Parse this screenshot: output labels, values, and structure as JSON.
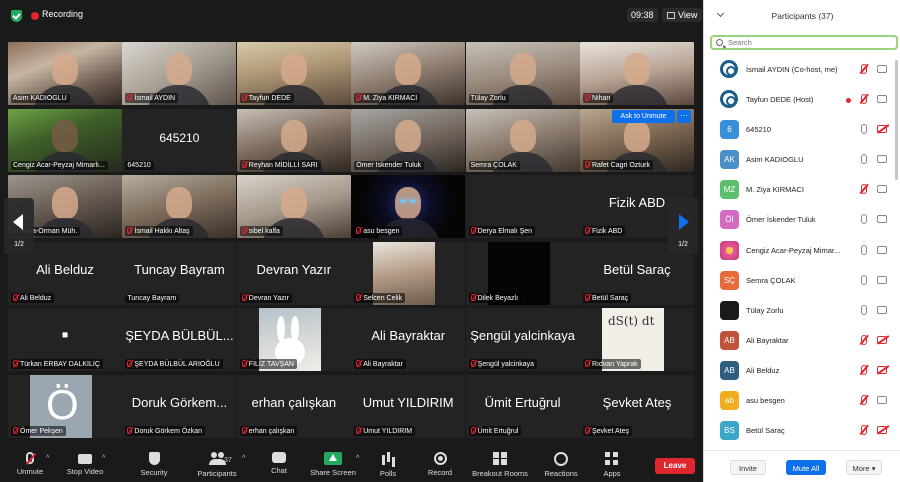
{
  "topbar": {
    "recording_label": "Recording",
    "timer": "09:38",
    "view_label": "View"
  },
  "grid": {
    "ask_to_unmute": "Ask to Unmute",
    "ask_more": "···",
    "page_left": "1/2",
    "page_right": "1/2",
    "tiles": [
      {
        "label": "Asim KADIOGLU",
        "display": "",
        "muted": false
      },
      {
        "label": "İsmail AYDIN",
        "display": "",
        "muted": true
      },
      {
        "label": "Tayfun DEDE",
        "display": "",
        "muted": true
      },
      {
        "label": "M. Ziya KIRMACI",
        "display": "",
        "muted": true
      },
      {
        "label": "Tülay Zorlu",
        "display": "",
        "muted": false
      },
      {
        "label": "Nihan",
        "display": "",
        "muted": true
      },
      {
        "label": "Cengiz Acar-Peyzaj Mimarlı...",
        "display": "",
        "muted": false
      },
      {
        "label": "645210",
        "display": "645210",
        "muted": false
      },
      {
        "label": "Reyhan MİDİLLİ SARI",
        "display": "",
        "muted": true
      },
      {
        "label": "Ömer İskender Tuluk",
        "display": "",
        "muted": false
      },
      {
        "label": "Semra ÇOLAK",
        "display": "",
        "muted": false
      },
      {
        "label": "Rafet Cagri Ozturk",
        "display": "",
        "muted": true
      },
      {
        "label": "er Kara-Orman Müh.",
        "display": "",
        "muted": false
      },
      {
        "label": "İsmail Hakkı Altaş",
        "display": "",
        "muted": true
      },
      {
        "label": "sibel kalfa",
        "display": "",
        "muted": true
      },
      {
        "label": "asu besgen",
        "display": "",
        "muted": true
      },
      {
        "label": "Derya Elmalı Şen",
        "display": "",
        "muted": true
      },
      {
        "label": "Fizik ABD",
        "display": "Fizik ABD",
        "muted": true
      },
      {
        "label": "Ali Belduz",
        "display": "Ali Belduz",
        "muted": true
      },
      {
        "label": "Tuncay Bayram",
        "display": "Tuncay Bayram",
        "muted": false
      },
      {
        "label": "Devran Yazır",
        "display": "Devran Yazır",
        "muted": true
      },
      {
        "label": "Selcen Celik",
        "display": "",
        "muted": true
      },
      {
        "label": "Dilek Beyazlı",
        "display": "",
        "muted": true
      },
      {
        "label": "Betül Saraç",
        "display": "Betül Saraç",
        "muted": true
      },
      {
        "label": "Türkan ERBAY DALKILIÇ",
        "display": "▪",
        "muted": true
      },
      {
        "label": "ŞEYDA BÜLBÜL ARIOĞLU",
        "display": "ŞEYDA BÜLBÜL...",
        "muted": true
      },
      {
        "label": "FİLİZ TAVŞAN",
        "display": "",
        "muted": true
      },
      {
        "label": "Ali Bayraktar",
        "display": "Ali Bayraktar",
        "muted": true
      },
      {
        "label": "Şengül yalcinkaya",
        "display": "Şengül yalcinkaya",
        "muted": true
      },
      {
        "label": "Rıdvan Yaprak",
        "display": "",
        "muted": true
      },
      {
        "label": "Ömer Pekşen",
        "display": "",
        "muted": true
      },
      {
        "label": "Doruk Görkem Özkan",
        "display": "Doruk Görkem...",
        "muted": true
      },
      {
        "label": "erhan çalışkan",
        "display": "erhan çalışkan",
        "muted": true
      },
      {
        "label": "Umut YILDIRIM",
        "display": "Umut YILDIRIM",
        "muted": true
      },
      {
        "label": "Ümit Ertuğrul",
        "display": "Ümit Ertuğrul",
        "muted": true
      },
      {
        "label": "Şevket Ateş",
        "display": "Şevket Ateş",
        "muted": true
      }
    ],
    "math_text": "dS(t) dt"
  },
  "toolbar": {
    "unmute": "Unmute",
    "stop_video": "Stop Video",
    "security": "Security",
    "participants": "Participants",
    "participants_count": "37",
    "chat": "Chat",
    "share_screen": "Share Screen",
    "polls": "Polls",
    "record": "Record",
    "breakout_rooms": "Breakout Rooms",
    "reactions": "Reactions",
    "apps": "Apps",
    "leave": "Leave"
  },
  "panel": {
    "title": "Participants (37)",
    "search_placeholder": "Search",
    "participants": [
      {
        "name": "İsmail AYDIN (Co-host, me)",
        "initials": "",
        "color": "#1a5d8a",
        "avatar": "logo",
        "mic": "muted",
        "cam": "on"
      },
      {
        "name": "Tayfun DEDE (Host)",
        "initials": "",
        "color": "#1a5d8a",
        "avatar": "logo",
        "mic": "muted",
        "cam": "on",
        "recording": true
      },
      {
        "name": "645210",
        "initials": "6",
        "color": "#3a8fd9",
        "avatar": "initials",
        "mic": "on",
        "cam": "off"
      },
      {
        "name": "Asim KADIOGLU",
        "initials": "AK",
        "color": "#4a90c8",
        "avatar": "initials",
        "mic": "on",
        "cam": "on"
      },
      {
        "name": "M. Ziya KIRMACI",
        "initials": "MZ",
        "color": "#5cbf6b",
        "avatar": "initials",
        "mic": "muted",
        "cam": "on"
      },
      {
        "name": "Ömer İskender Tuluk",
        "initials": "ÖI",
        "color": "#d36bc2",
        "avatar": "initials",
        "mic": "on",
        "cam": "on"
      },
      {
        "name": "Cengiz Acar-Peyzaj Mimar...",
        "initials": "",
        "color": "#e8589a",
        "avatar": "flower",
        "mic": "on",
        "cam": "on"
      },
      {
        "name": "Semra ÇOLAK",
        "initials": "SÇ",
        "color": "#e86a3a",
        "avatar": "initials",
        "mic": "on",
        "cam": "on"
      },
      {
        "name": "Tülay Zorlu",
        "initials": "",
        "color": "#1a1a1a",
        "avatar": "initials",
        "mic": "on",
        "cam": "on"
      },
      {
        "name": "Ali Bayraktar",
        "initials": "AB",
        "color": "#c0523a",
        "avatar": "initials",
        "mic": "muted",
        "cam": "off"
      },
      {
        "name": "Ali Belduz",
        "initials": "AB",
        "color": "#2f5d7f",
        "avatar": "initials",
        "mic": "muted",
        "cam": "off"
      },
      {
        "name": "asu besgen",
        "initials": "ab",
        "color": "#f0ad1e",
        "avatar": "initials",
        "mic": "muted",
        "cam": "on"
      },
      {
        "name": "Betül Saraç",
        "initials": "BS",
        "color": "#3aa6c8",
        "avatar": "initials",
        "mic": "muted",
        "cam": "off"
      }
    ],
    "invite": "Invite",
    "mute_all": "Mute All",
    "more": "More"
  }
}
